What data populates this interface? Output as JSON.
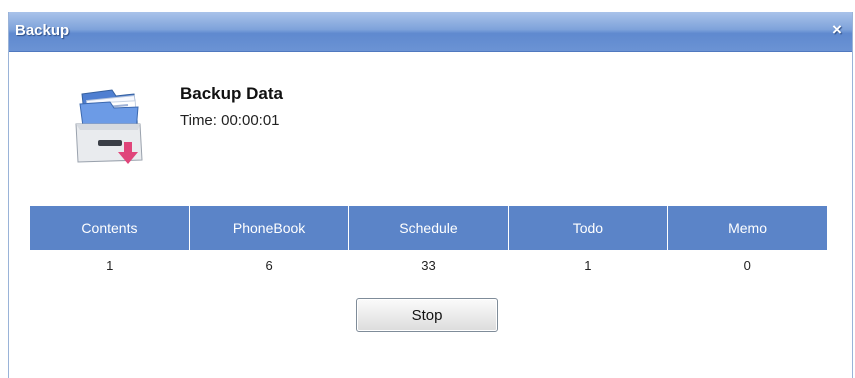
{
  "window": {
    "title": "Backup",
    "close_symbol": "×"
  },
  "header": {
    "icon": "backup-drawer-icon",
    "heading": "Backup Data",
    "time_label": "Time:",
    "time_value": "00:00:01"
  },
  "table": {
    "headers": [
      "Contents",
      "PhoneBook",
      "Schedule",
      "Todo",
      "Memo"
    ],
    "values": [
      "1",
      "6",
      "33",
      "1",
      "0"
    ]
  },
  "actions": {
    "stop_label": "Stop"
  },
  "colors": {
    "titlebar": "#6b93d4",
    "table_header": "#5b84c8",
    "accent_pink": "#e0457a"
  }
}
